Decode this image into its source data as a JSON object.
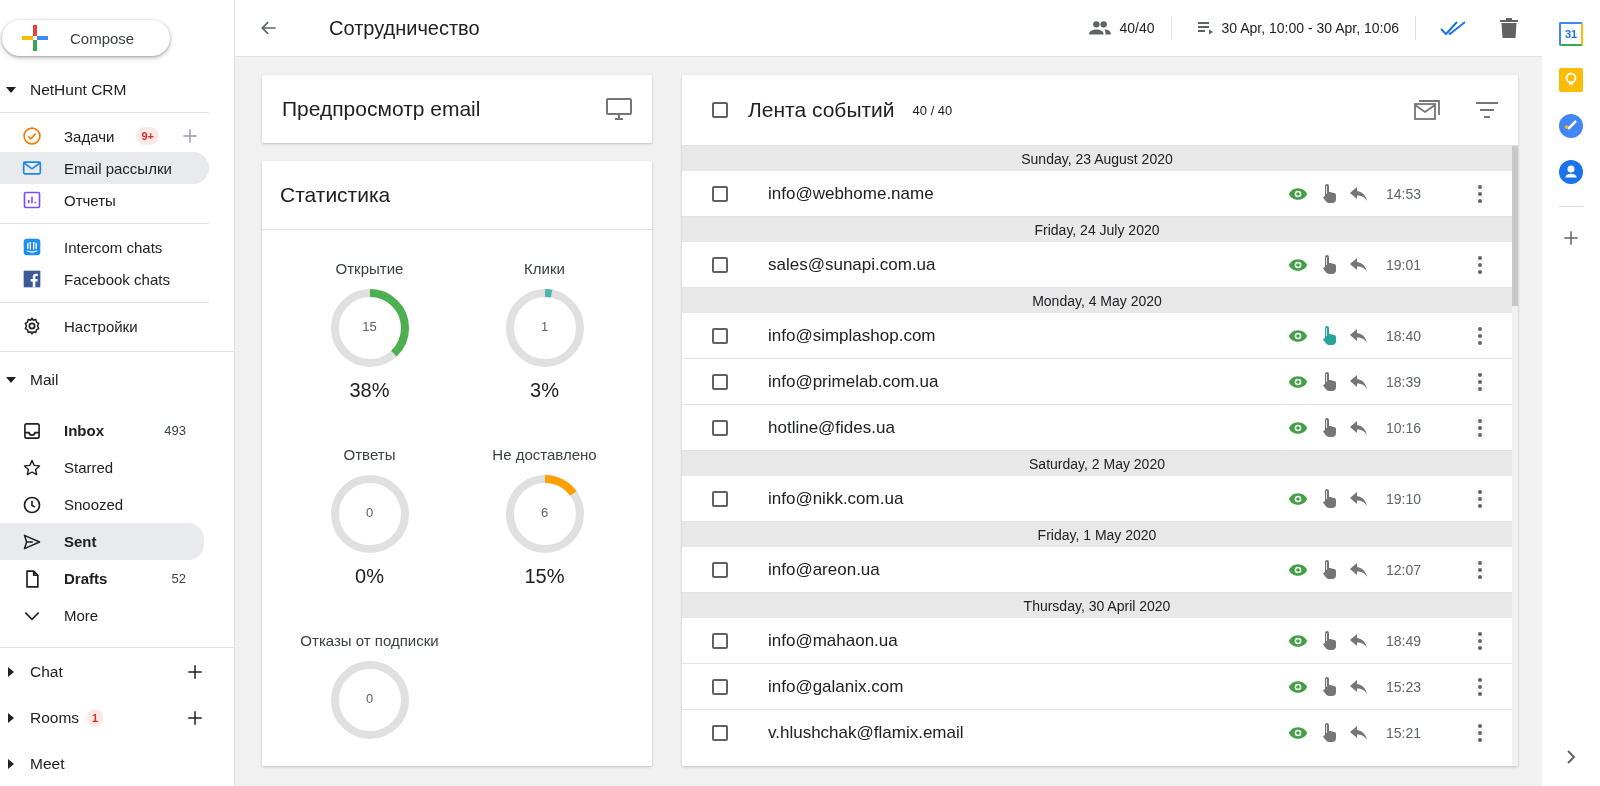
{
  "compose": {
    "label": "Compose"
  },
  "sidebar": {
    "sections": [
      {
        "title": "NetHunt CRM",
        "expanded": true,
        "groups": [
          [
            {
              "label": "Задачи",
              "badge": "9+",
              "add": true,
              "selected": false
            },
            {
              "label": "Email рассылки",
              "selected": true
            },
            {
              "label": "Отчеты",
              "selected": false
            }
          ],
          [
            {
              "label": "Intercom chats",
              "selected": false
            },
            {
              "label": "Facebook chats",
              "selected": false
            }
          ],
          [
            {
              "label": "Настройки",
              "selected": false
            }
          ]
        ]
      },
      {
        "title": "Mail",
        "expanded": true,
        "groups": [
          [
            {
              "label": "Inbox",
              "count": "493",
              "selected": false,
              "unread": true
            },
            {
              "label": "Starred",
              "selected": false,
              "unread": false
            },
            {
              "label": "Snoozed",
              "selected": false,
              "unread": false
            },
            {
              "label": "Sent",
              "selected": true,
              "unread": false
            },
            {
              "label": "Drafts",
              "count": "52",
              "selected": false,
              "unread": true
            },
            {
              "label": "More",
              "selected": false,
              "unread": false
            }
          ]
        ]
      },
      {
        "title": "Chat",
        "expanded": false,
        "add": true
      },
      {
        "title": "Rooms",
        "expanded": false,
        "badge": "1",
        "add": true
      },
      {
        "title": "Meet",
        "expanded": false
      }
    ]
  },
  "topbar": {
    "title": "Сотрудничество",
    "participants": "40/40",
    "period": "30 Apr, 10:00 - 30 Apr, 10:06"
  },
  "preview_card": {
    "title": "Предпросмотр email"
  },
  "stats_card": {
    "title": "Статистика",
    "items": [
      {
        "label": "Открытие",
        "value": "15",
        "percent": "38%",
        "level": 0.38,
        "color": "#4caf50"
      },
      {
        "label": "Клики",
        "value": "1",
        "percent": "3%",
        "level": 0.03,
        "color": "#4db6ac"
      },
      {
        "label": "Ответы",
        "value": "0",
        "percent": "0%"
      },
      {
        "label": "Не доставлено",
        "value": "6",
        "percent": "15%",
        "level": 0.15,
        "color": "#ffa000"
      },
      {
        "label": "Отказы от подписки",
        "value": "0"
      }
    ]
  },
  "feed": {
    "title": "Лента событий",
    "count": "40 / 40",
    "checked": false,
    "groups": [
      {
        "date": "Sunday, 23 August 2020",
        "rows": [
          {
            "email": "info@webhome.name",
            "time": "14:53",
            "checked": false,
            "opened": true,
            "clicked": false,
            "replied": false
          }
        ]
      },
      {
        "date": "Friday, 24 July 2020",
        "rows": [
          {
            "email": "sales@sunapi.com.ua",
            "time": "19:01",
            "checked": false,
            "opened": true,
            "clicked": false,
            "replied": false
          }
        ]
      },
      {
        "date": "Monday, 4 May 2020",
        "rows": [
          {
            "email": "info@simplashop.com",
            "time": "18:40",
            "checked": false,
            "opened": true,
            "clicked": true,
            "replied": false
          },
          {
            "email": "info@primelab.com.ua",
            "time": "18:39",
            "checked": false,
            "opened": true,
            "clicked": false,
            "replied": false
          },
          {
            "email": "hotline@fides.ua",
            "time": "10:16",
            "checked": false,
            "opened": true,
            "clicked": false,
            "replied": false
          }
        ]
      },
      {
        "date": "Saturday, 2 May 2020",
        "rows": [
          {
            "email": "info@nikk.com.ua",
            "time": "19:10",
            "checked": false,
            "opened": true,
            "clicked": false,
            "replied": false
          }
        ]
      },
      {
        "date": "Friday, 1 May 2020",
        "rows": [
          {
            "email": "info@areon.ua",
            "time": "12:07",
            "checked": false,
            "opened": true,
            "clicked": false,
            "replied": false
          }
        ]
      },
      {
        "date": "Thursday, 30 April 2020",
        "rows": [
          {
            "email": "info@mahaon.ua",
            "time": "18:49",
            "checked": false,
            "opened": true,
            "clicked": false,
            "replied": false
          },
          {
            "email": "info@galanix.com",
            "time": "15:23",
            "checked": false,
            "opened": true,
            "clicked": false,
            "replied": false
          },
          {
            "email": "v.hlushchak@flamix.email",
            "time": "15:21",
            "checked": false,
            "opened": true,
            "clicked": false,
            "replied": false
          }
        ]
      }
    ]
  },
  "rail": {
    "calendar_day": "31"
  }
}
